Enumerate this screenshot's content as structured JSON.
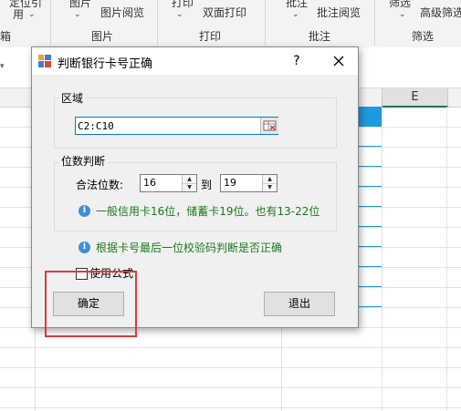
{
  "ribbon": {
    "item1_line1": "定位引",
    "item1_line2": "用",
    "group1_label": "箱",
    "item2_line1": "图片",
    "item2_caret": "⌄",
    "item3": "图片阅览",
    "group2_label": "图片",
    "item4_line1": "打印",
    "item5": "双面打印",
    "group3_label": "打印",
    "item6_line1": "批注",
    "item7": "批注阅览",
    "group4_label": "批注",
    "item8_line1": "筛选",
    "item9": "高级筛选",
    "group5_label": "筛选"
  },
  "sheet": {
    "column_e": "E"
  },
  "dialog": {
    "title": "判断银行卡号正确",
    "help": "?",
    "range_group": "区域",
    "range_value": "C2:C10",
    "digits_group": "位数判断",
    "legal_digits_label": "合法位数:",
    "min_digits": "16",
    "to_label": "到",
    "max_digits": "19",
    "hint1": "一般信用卡16位，储蓄卡19位。也有13-22位",
    "hint2": "根据卡号最后一位校验码判断是否正确",
    "use_formula_label": "使用公式",
    "ok_button": "确定",
    "exit_button": "退出"
  },
  "colors": {
    "highlight": "#e03838",
    "hint_text": "#1a7a1a",
    "info_icon": "#3d8fd9",
    "selection": "#1e9ae0"
  }
}
